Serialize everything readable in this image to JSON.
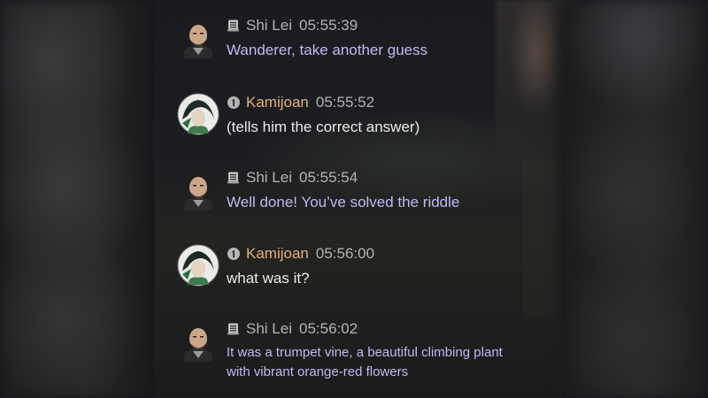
{
  "chat": {
    "messages": [
      {
        "speaker": "Shi Lei",
        "speaker_type": "npc",
        "role_icon": "scroll-icon",
        "time": "05:55:39",
        "text": "Wanderer, take another guess"
      },
      {
        "speaker": "Kamijoan",
        "speaker_type": "player",
        "role_icon": "player-badge-icon",
        "time": "05:55:52",
        "text": "(tells him the correct answer)"
      },
      {
        "speaker": "Shi Lei",
        "speaker_type": "npc",
        "role_icon": "scroll-icon",
        "time": "05:55:54",
        "text": "Well done! You’ve solved the riddle"
      },
      {
        "speaker": "Kamijoan",
        "speaker_type": "player",
        "role_icon": "player-badge-icon",
        "time": "05:56:00",
        "text": "what was it?"
      },
      {
        "speaker": "Shi Lei",
        "speaker_type": "npc",
        "role_icon": "scroll-icon",
        "time": "05:56:02",
        "text_line1": "It was a trumpet vine, a beautiful climbing plant",
        "text_line2": "with vibrant orange-red flowers"
      }
    ]
  },
  "colors": {
    "npc_name": "#b3b3b3",
    "player_name": "#e2b179",
    "npc_text": "#b9bdf1",
    "player_text": "#e9e9e9",
    "timestamp": "#b3b3b3"
  }
}
